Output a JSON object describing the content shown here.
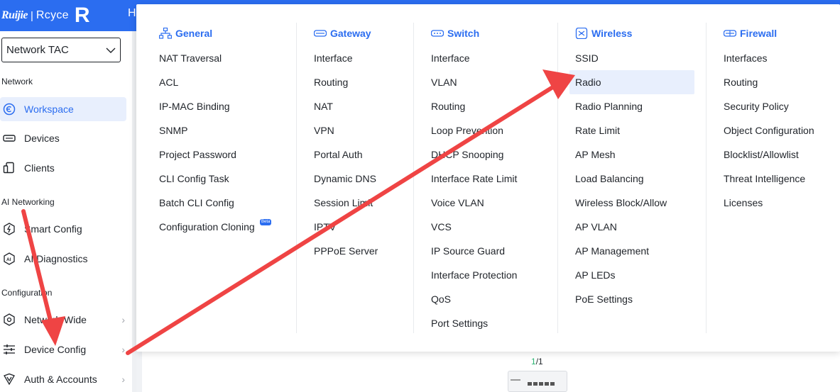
{
  "header": {
    "brand": "Ruijie",
    "separator": "|",
    "sub_brand": "Rcyce",
    "mark": "R",
    "peek_label": "H"
  },
  "sidebar": {
    "network_select": "Network TAC",
    "sections": {
      "network": "Network",
      "ai": "AI Networking",
      "config": "Configuration"
    },
    "items": [
      {
        "label": "Workspace",
        "icon": "workspace-icon"
      },
      {
        "label": "Devices",
        "icon": "devices-icon"
      },
      {
        "label": "Clients",
        "icon": "clients-icon"
      },
      {
        "label": "Smart Config",
        "icon": "smart-config-icon"
      },
      {
        "label": "AI Diagnostics",
        "icon": "ai-diagnostics-icon"
      },
      {
        "label": "Network-Wide",
        "icon": "network-wide-icon"
      },
      {
        "label": "Device Config",
        "icon": "sliders-icon"
      },
      {
        "label": "Auth & Accounts",
        "icon": "shield-icon"
      }
    ],
    "chevron": "›"
  },
  "menu": {
    "general": {
      "title": "General",
      "items": [
        "NAT Traversal",
        "ACL",
        "IP-MAC Binding",
        "SNMP",
        "Project Password",
        "CLI Config Task",
        "Batch CLI Config",
        "Configuration Cloning"
      ],
      "beta": "Beta"
    },
    "gateway": {
      "title": "Gateway",
      "items": [
        "Interface",
        "Routing",
        "NAT",
        "VPN",
        "Portal Auth",
        "Dynamic DNS",
        "Session Limit",
        "IPTV",
        "PPPoE Server"
      ]
    },
    "switch": {
      "title": "Switch",
      "items": [
        "Interface",
        "VLAN",
        "Routing",
        "Loop Prevention",
        "DHCP Snooping",
        "Interface Rate Limit",
        "Voice VLAN",
        "VCS",
        "IP Source Guard",
        "Interface Protection",
        "QoS",
        "Port Settings"
      ]
    },
    "wireless": {
      "title": "Wireless",
      "items": [
        "SSID",
        "Radio",
        "Radio Planning",
        "Rate Limit",
        "AP Mesh",
        "Load Balancing",
        "Wireless Block/Allow",
        "AP VLAN",
        "AP Management",
        "AP LEDs",
        "PoE Settings"
      ]
    },
    "firewall": {
      "title": "Firewall",
      "items": [
        "Interfaces",
        "Routing",
        "Security Policy",
        "Object Configuration",
        "Blocklist/Allowlist",
        "Threat Intelligence",
        "Licenses"
      ]
    }
  },
  "content": {
    "counter_a": "1",
    "counter_b": "/1"
  },
  "colors": {
    "accent": "#2b6df0",
    "highlight": "#e8effd",
    "annotation_arrow": "#ef4444"
  }
}
